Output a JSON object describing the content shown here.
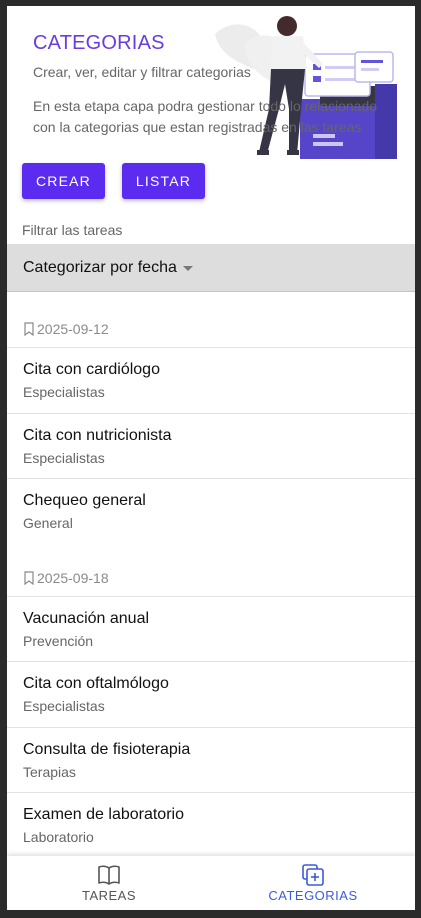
{
  "header": {
    "title": "CATEGORIAS",
    "subtitle": "Crear, ver, editar y filtrar categorias",
    "description": "En esta etapa capa podra gestionar todo lo relacionado con la categorias que estan registradas en las tareas"
  },
  "actions": {
    "create_label": "CREAR",
    "list_label": "LISTAR"
  },
  "filter": {
    "label": "Filtrar las tareas",
    "selected": "Categorizar por fecha"
  },
  "groups": [
    {
      "date": "2025-09-12",
      "items": [
        {
          "title": "Cita con cardiólogo",
          "category": "Especialistas"
        },
        {
          "title": "Cita con nutricionista",
          "category": "Especialistas"
        },
        {
          "title": "Chequeo general",
          "category": "General"
        }
      ]
    },
    {
      "date": "2025-09-18",
      "items": [
        {
          "title": "Vacunación anual",
          "category": "Prevención"
        },
        {
          "title": "Cita con oftalmólogo",
          "category": "Especialistas"
        },
        {
          "title": "Consulta de fisioterapia",
          "category": "Terapias"
        },
        {
          "title": "Examen de laboratorio",
          "category": "Laboratorio"
        }
      ]
    }
  ],
  "nav": {
    "tasks_label": "TAREAS",
    "categories_label": "CATEGORIAS",
    "tasks_icon": "book-icon",
    "categories_icon": "add-box-icon",
    "active": "categories"
  },
  "colors": {
    "accent": "#5b2bf0",
    "title": "#6a3be0",
    "nav_active": "#3b5bdb"
  }
}
